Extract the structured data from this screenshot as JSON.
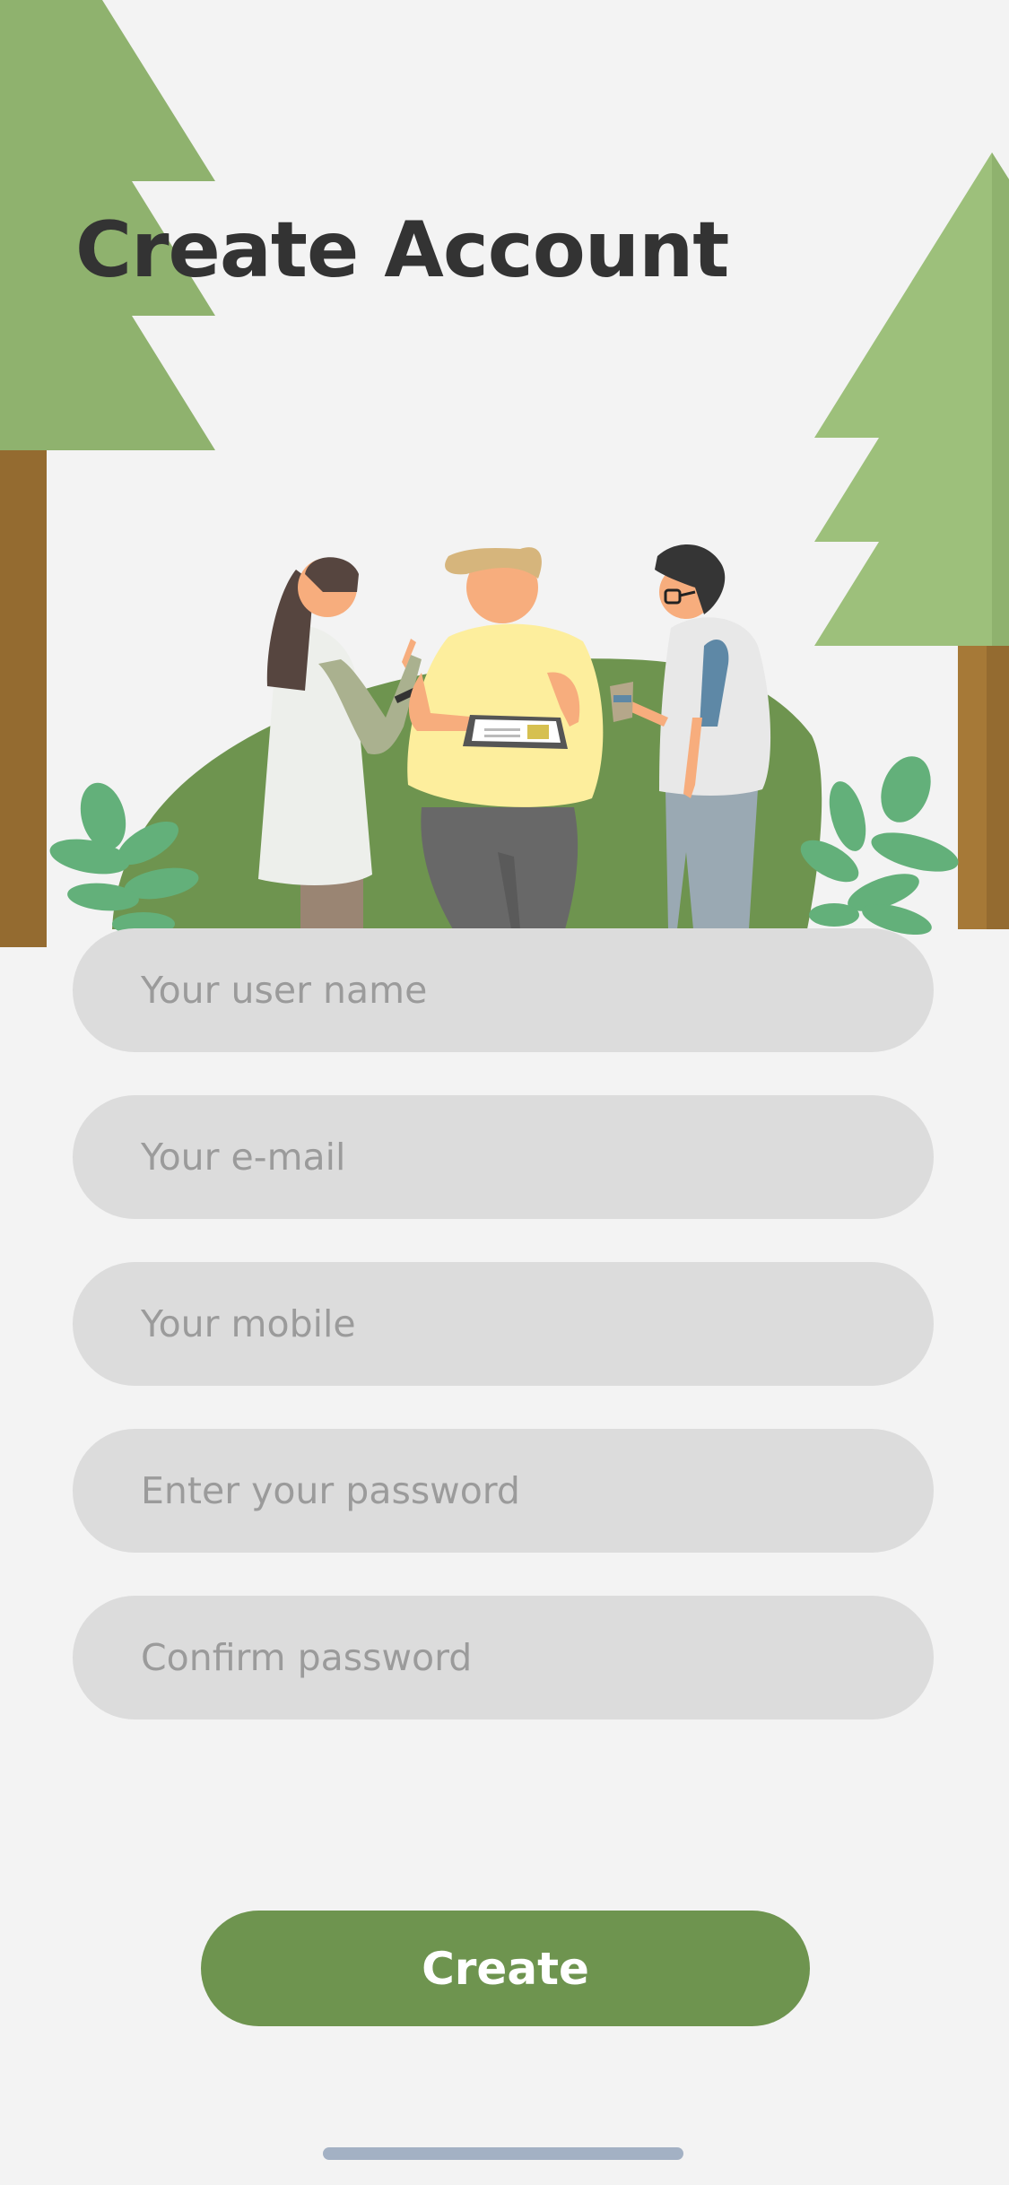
{
  "header": {
    "title": "Create Account"
  },
  "form": {
    "username": {
      "placeholder": "Your user name",
      "value": ""
    },
    "email": {
      "placeholder": "Your e-mail",
      "value": ""
    },
    "mobile": {
      "placeholder": "Your mobile",
      "value": ""
    },
    "password": {
      "placeholder": "Enter your password",
      "value": ""
    },
    "confirm_password": {
      "placeholder": "Confirm password",
      "value": ""
    }
  },
  "actions": {
    "create_label": "Create"
  },
  "colors": {
    "background": "#f3f3f3",
    "accent_green": "#6e944f",
    "field_gray": "#dcdcdc",
    "title_text": "#333333",
    "placeholder_text": "#9b9b9b",
    "tree_green": "#8fb26e",
    "trunk_brown": "#946b30"
  },
  "illustration": {
    "name": "team-collaboration-illustration"
  }
}
